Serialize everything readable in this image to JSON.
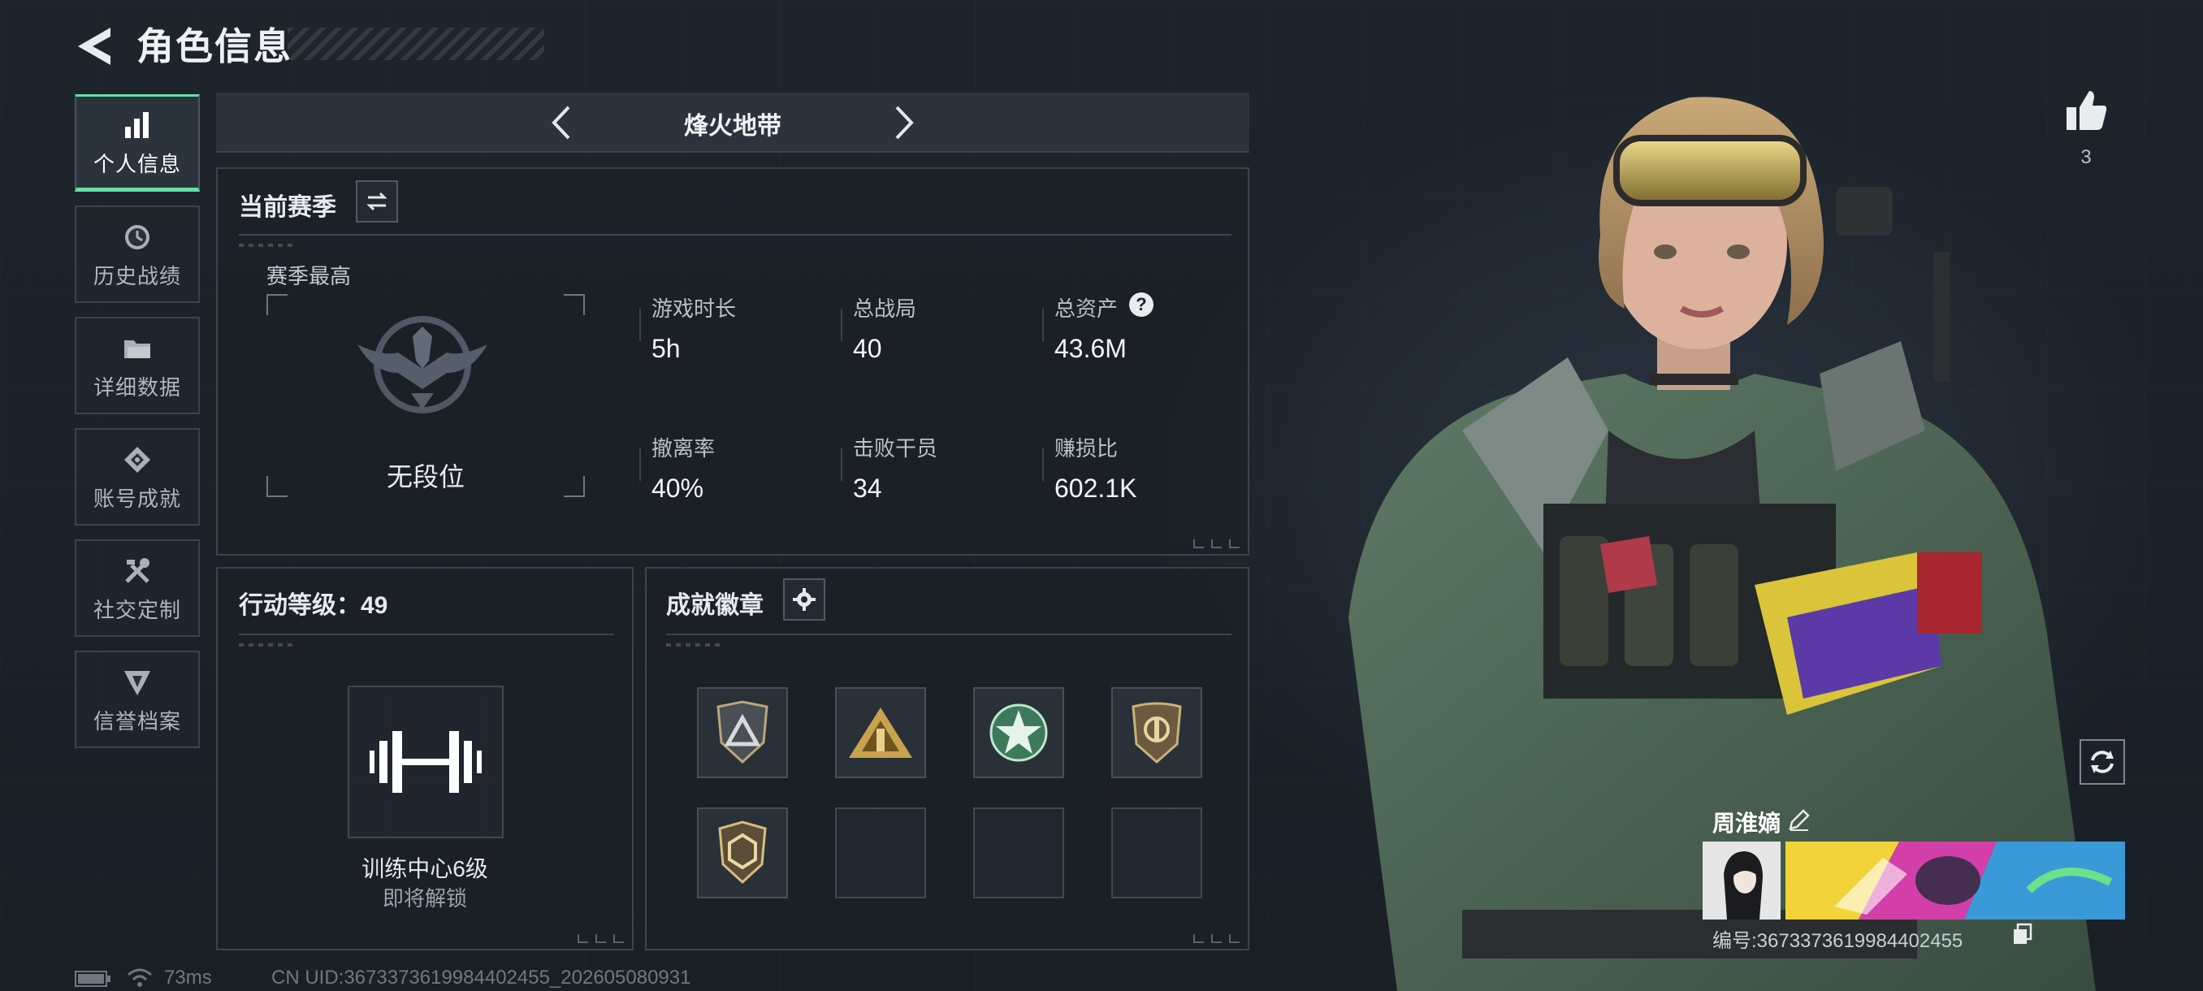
{
  "header": {
    "title": "角色信息"
  },
  "sidebar": {
    "items": [
      {
        "label": "个人信息",
        "icon": "bar-chart-icon",
        "active": true
      },
      {
        "label": "历史战绩",
        "icon": "history-clock-icon",
        "active": false
      },
      {
        "label": "详细数据",
        "icon": "folder-icon",
        "active": false
      },
      {
        "label": "账号成就",
        "icon": "medal-icon",
        "active": false
      },
      {
        "label": "社交定制",
        "icon": "tools-icon",
        "active": false
      },
      {
        "label": "信誉档案",
        "icon": "shield-emblem-icon",
        "active": false
      }
    ]
  },
  "mode": {
    "title": "烽火地带"
  },
  "season": {
    "title": "当前赛季",
    "highest_label": "赛季最高",
    "rank": "无段位",
    "stats": [
      {
        "label": "游戏时长",
        "value": "5h"
      },
      {
        "label": "总战局",
        "value": "40"
      },
      {
        "label": "总资产",
        "value": "43.6M",
        "help": "?"
      },
      {
        "label": "撤离率",
        "value": "40%"
      },
      {
        "label": "击败干员",
        "value": "34"
      },
      {
        "label": "赚损比",
        "value": "602.1K"
      }
    ]
  },
  "action_level": {
    "title": "行动等级：49",
    "facility": "训练中心6级",
    "status": "即将解锁"
  },
  "achievements": {
    "title": "成就徽章",
    "badges": [
      {
        "name": "triangle-shield-badge",
        "filled": true
      },
      {
        "name": "golden-pyramid-badge",
        "filled": true
      },
      {
        "name": "green-star-badge",
        "filled": true
      },
      {
        "name": "bronze-crest-badge",
        "filled": true
      },
      {
        "name": "gold-hex-badge",
        "filled": true
      },
      {
        "name": "empty-slot",
        "filled": false
      },
      {
        "name": "empty-slot",
        "filled": false
      },
      {
        "name": "empty-slot",
        "filled": false
      }
    ]
  },
  "likes": {
    "count": "3"
  },
  "player": {
    "name": "周淮嫡",
    "id_text": "编号:3673373619984402455"
  },
  "status": {
    "ping": "73ms",
    "uid": "CN UID:3673373619984402455_202605080931"
  },
  "colors": {
    "accent": "#65e0a6",
    "panel_border": "#3b434e",
    "background": "#1b2129"
  }
}
